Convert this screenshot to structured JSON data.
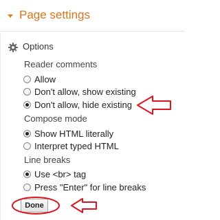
{
  "header": {
    "title": "Page settings"
  },
  "options": {
    "label": "Options",
    "icon": "gear-icon"
  },
  "reader_comments": {
    "label": "Reader comments",
    "items": [
      {
        "label": "Allow",
        "selected": false
      },
      {
        "label": "Don't allow, show existing",
        "selected": false
      },
      {
        "label": "Don't allow, hide existing",
        "selected": true
      }
    ]
  },
  "compose_mode": {
    "label": "Compose mode",
    "items": [
      {
        "label": "Show HTML literally",
        "selected": true
      },
      {
        "label": "Interpret typed HTML",
        "selected": false
      }
    ]
  },
  "line_breaks": {
    "label": "Line breaks",
    "items": [
      {
        "label": "Use <br> tag",
        "selected": true
      },
      {
        "label": "Press \"Enter\" for line breaks",
        "selected": false
      }
    ]
  },
  "done": {
    "label": "Done"
  },
  "colors": {
    "accent": "#d9741c",
    "annotation": "#e0141e"
  }
}
